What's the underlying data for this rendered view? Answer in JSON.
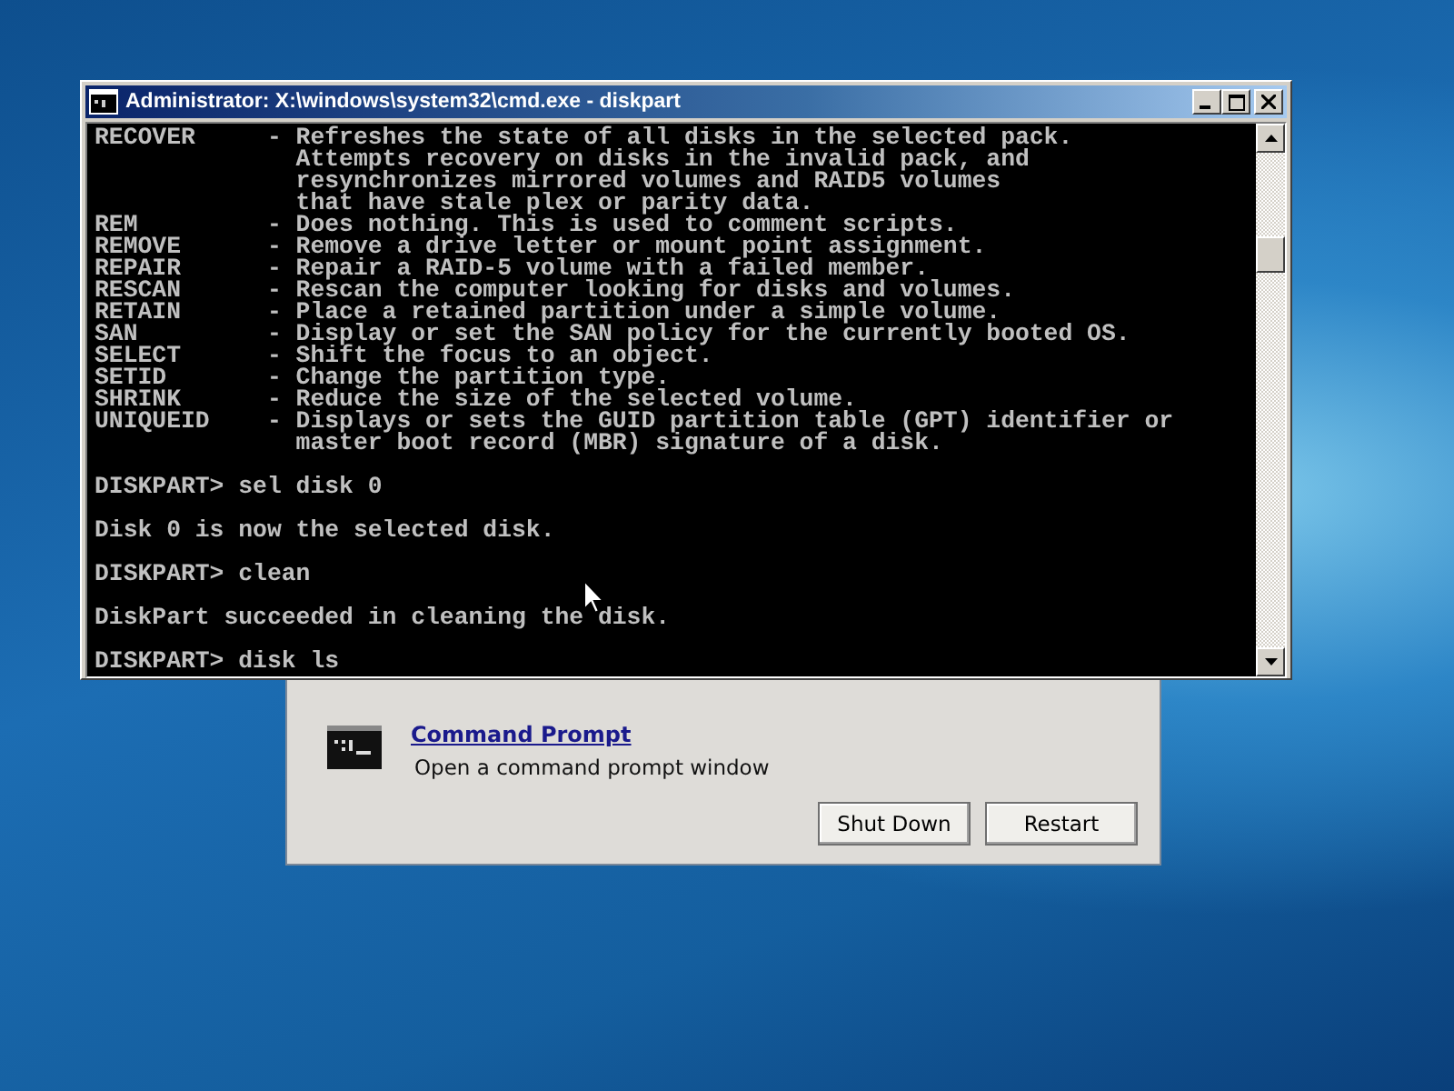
{
  "dialog": {
    "tool": {
      "name": "Command Prompt",
      "description": "Open a command prompt window"
    },
    "buttons": [
      "Shut Down",
      "Restart"
    ]
  },
  "window": {
    "title": "Administrator: X:\\windows\\system32\\cmd.exe - diskpart"
  },
  "console": {
    "blocks": [
      [
        "RECOVER     - Refreshes the state of all disks in the selected pack.",
        "              Attempts recovery on disks in the invalid pack, and",
        "              resynchronizes mirrored volumes and RAID5 volumes",
        "              that have stale plex or parity data.",
        "REM         - Does nothing. This is used to comment scripts.",
        "REMOVE      - Remove a drive letter or mount point assignment.",
        "REPAIR      - Repair a RAID-5 volume with a failed member.",
        "RESCAN      - Rescan the computer looking for disks and volumes.",
        "RETAIN      - Place a retained partition under a simple volume.",
        "SAN         - Display or set the SAN policy for the currently booted OS.",
        "SELECT      - Shift the focus to an object.",
        "SETID       - Change the partition type.",
        "SHRINK      - Reduce the size of the selected volume.",
        "UNIQUEID    - Displays or sets the GUID partition table (GPT) identifier or",
        "              master boot record (MBR) signature of a disk."
      ],
      [
        "DISKPART> sel disk 0"
      ],
      [
        "Disk 0 is now the selected disk."
      ],
      [
        "DISKPART> clean"
      ],
      [
        "DiskPart succeeded in cleaning the disk."
      ],
      [
        "DISKPART> disk ls"
      ]
    ]
  }
}
